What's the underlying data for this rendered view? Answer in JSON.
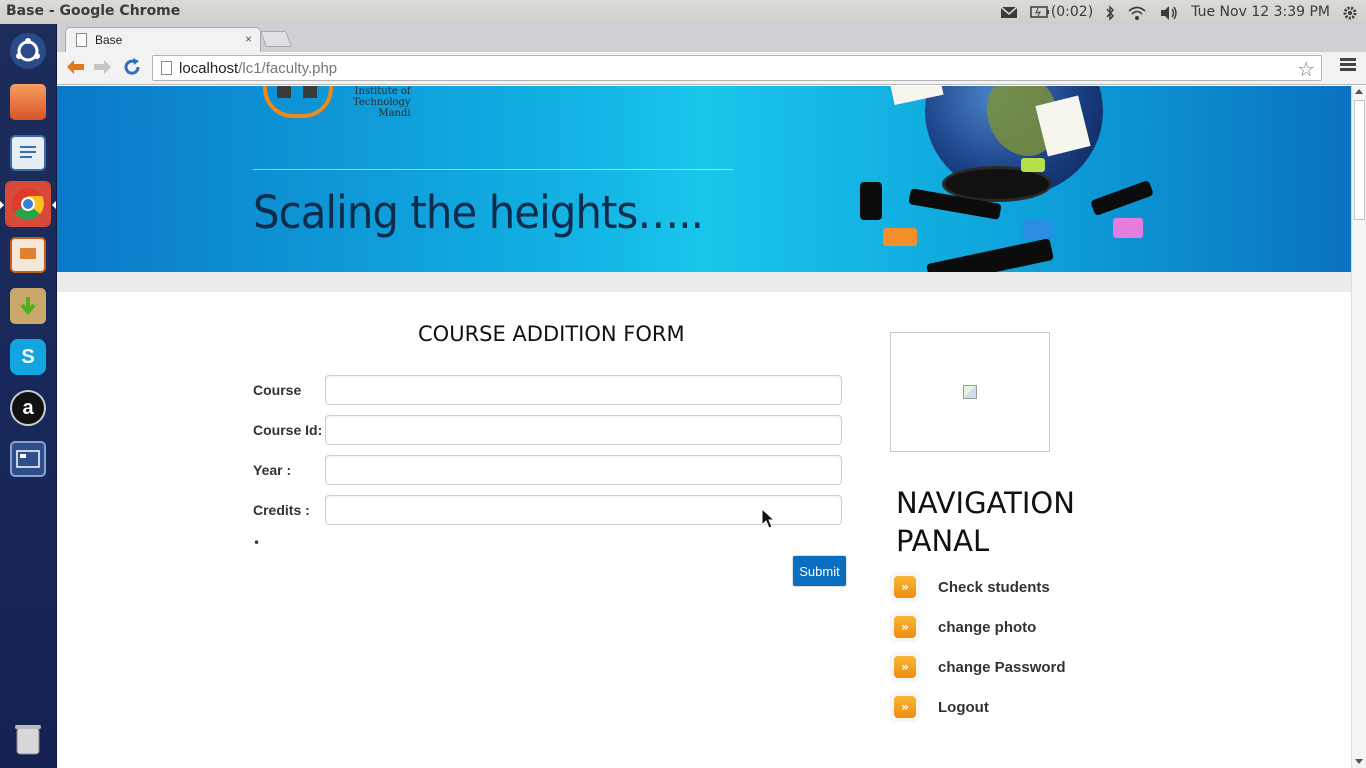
{
  "os": {
    "window_title": "Base - Google Chrome",
    "battery_text": "(0:02)",
    "datetime": "Tue Nov 12  3:39 PM"
  },
  "browser": {
    "tab_title": "Base",
    "tab_close": "×",
    "url_host": "localhost",
    "url_path": "/lc1/faculty.php"
  },
  "banner": {
    "logo_line1": "Institute of",
    "logo_line2": "Technology",
    "logo_line3": "Mandi",
    "tagline": "Scaling the heights….."
  },
  "form": {
    "title": "COURSE ADDITION FORM",
    "fields": [
      {
        "label": "Course",
        "value": ""
      },
      {
        "label": "Course Id:",
        "value": ""
      },
      {
        "label": "Year :",
        "value": ""
      },
      {
        "label": "Credits :",
        "value": ""
      }
    ],
    "bullet": "•",
    "submit_label": "Submit"
  },
  "sidebar": {
    "heading": "NAVIGATION PANAL",
    "bullet_glyph": "»",
    "items": [
      {
        "label": "Check students"
      },
      {
        "label": "change photo"
      },
      {
        "label": "change Password"
      },
      {
        "label": "Logout"
      }
    ]
  },
  "colors": {
    "submit_bg": "#0a6ec0",
    "nav_bullet": "#f39c12",
    "banner_blue": "#12b3e4"
  }
}
